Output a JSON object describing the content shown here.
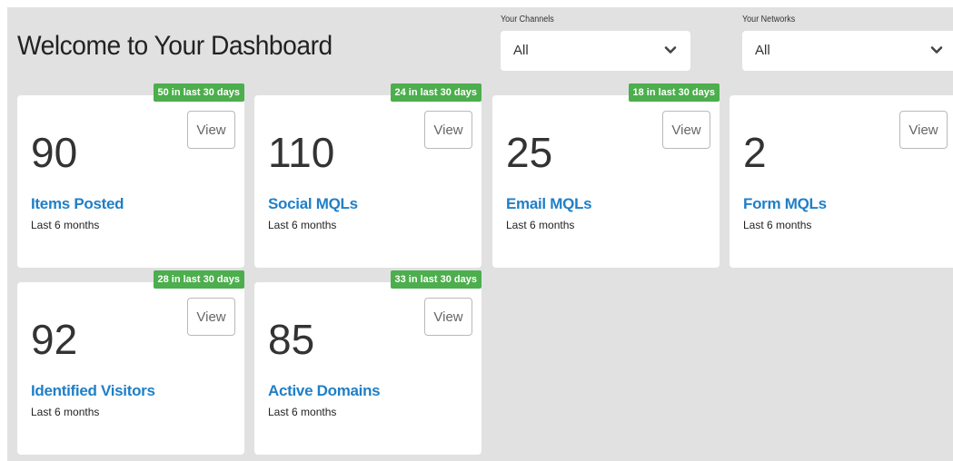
{
  "header": {
    "title": "Welcome to Your Dashboard"
  },
  "filters": {
    "channels": {
      "label": "Your Channels",
      "value": "All"
    },
    "networks": {
      "label": "Your Networks",
      "value": "All"
    }
  },
  "cards": [
    {
      "value": "90",
      "label": "Items Posted",
      "period": "Last 6 months",
      "badge": "50 in last 30 days",
      "view": "View"
    },
    {
      "value": "110",
      "label": "Social MQLs",
      "period": "Last 6 months",
      "badge": "24 in last 30 days",
      "view": "View"
    },
    {
      "value": "25",
      "label": "Email MQLs",
      "period": "Last 6 months",
      "badge": "18 in last 30 days",
      "view": "View"
    },
    {
      "value": "2",
      "label": "Form MQLs",
      "period": "Last 6 months",
      "badge": "",
      "view": "View"
    },
    {
      "value": "92",
      "label": "Identified Visitors",
      "period": "Last 6 months",
      "badge": "28 in last 30 days",
      "view": "View"
    },
    {
      "value": "85",
      "label": "Active Domains",
      "period": "Last 6 months",
      "badge": "33 in last 30 days",
      "view": "View"
    }
  ],
  "colors": {
    "badge": "#4cae4c",
    "link": "#1f7fc7",
    "background": "#e1e1e1"
  },
  "icons": {
    "select_chevron": "chevron-down-icon"
  }
}
